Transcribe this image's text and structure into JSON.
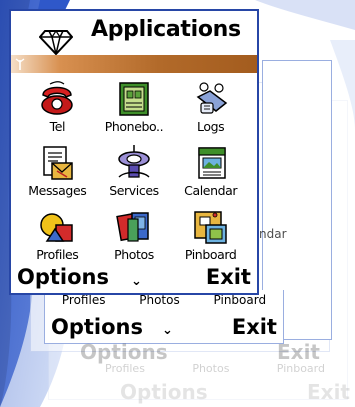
{
  "window": {
    "title": "Applications",
    "apps": [
      {
        "label": "Tel",
        "icon": "telephone-icon"
      },
      {
        "label": "Phonebo..",
        "icon": "phonebook-icon"
      },
      {
        "label": "Logs",
        "icon": "logs-icon"
      },
      {
        "label": "Messages",
        "icon": "messages-icon"
      },
      {
        "label": "Services",
        "icon": "services-icon"
      },
      {
        "label": "Calendar",
        "icon": "calendar-icon"
      },
      {
        "label": "Profiles",
        "icon": "profiles-icon"
      },
      {
        "label": "Photos",
        "icon": "photos-icon"
      },
      {
        "label": "Pinboard",
        "icon": "pinboard-icon"
      }
    ],
    "softkeys": {
      "left": "Options",
      "right": "Exit",
      "middle": "⌄"
    }
  },
  "ghost_window_2": {
    "labels": [
      "Profiles",
      "Photos",
      "Pinboard"
    ],
    "softkeys": {
      "left": "Options",
      "right": "Exit",
      "middle": "⌄"
    }
  },
  "ghost_window_3": {
    "softkeys": {
      "left": "Options",
      "right": "Exit"
    },
    "labels": [
      "Profiles",
      "Photos",
      "Pinboard"
    ],
    "side_labels": [
      "ndar",
      "dar",
      "ndar"
    ]
  },
  "ghost_window_4": {
    "softkeys": {
      "left": "Options",
      "right": "Exit"
    }
  },
  "colors": {
    "window_border": "#2746a6",
    "title_bar_gradient_end": "#a35c1e"
  }
}
